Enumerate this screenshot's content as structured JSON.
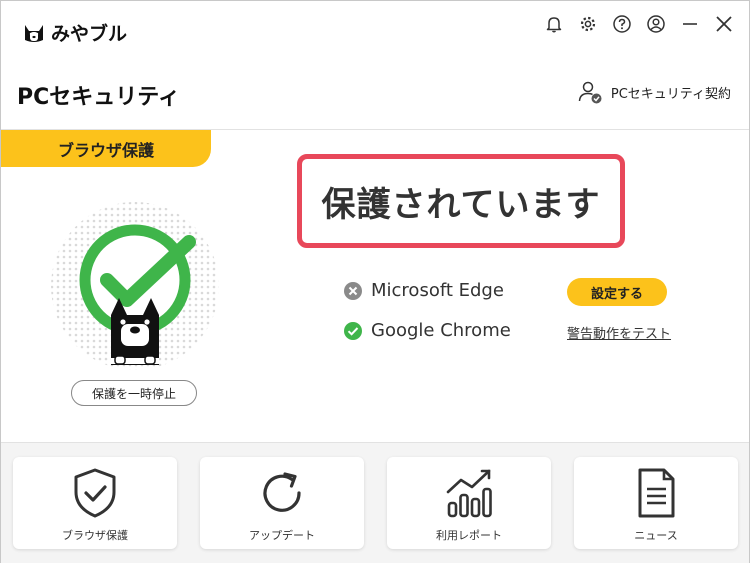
{
  "app": {
    "name": "みやブル"
  },
  "header": {
    "title": "PCセキュリティ",
    "contract_label": "PCセキュリティ契約"
  },
  "section_tag": "ブラウザ保護",
  "status": {
    "text": "保護されています"
  },
  "pause_button": "保護を一時停止",
  "browsers": [
    {
      "name": "Microsoft Edge",
      "state": "not-protected",
      "icon": "x-circle-icon"
    },
    {
      "name": "Google Chrome",
      "state": "protected",
      "icon": "check-circle-icon"
    }
  ],
  "setup_button": "設定する",
  "test_link": "警告動作をテスト",
  "tiles": [
    {
      "label": "ブラウザ保護",
      "icon": "shield-check-icon"
    },
    {
      "label": "アップデート",
      "icon": "refresh-icon"
    },
    {
      "label": "利用レポート",
      "icon": "bar-chart-icon"
    },
    {
      "label": "ニュース",
      "icon": "document-icon"
    }
  ],
  "colors": {
    "accent": "#fcc21b",
    "highlight": "#e8485a",
    "ok": "#3fb54a",
    "muted": "#8a8a8a"
  }
}
